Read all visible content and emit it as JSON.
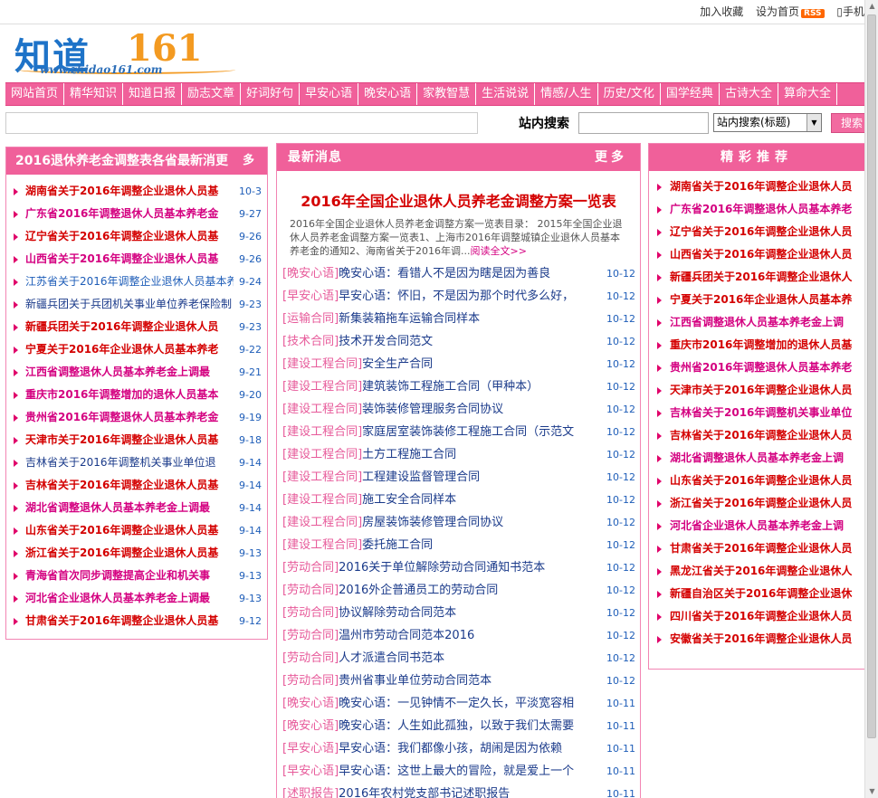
{
  "toplinks": {
    "bookmark": "加入收藏",
    "homepage": "设为首页",
    "rss": "RSS",
    "phone": "手机"
  },
  "logo": {
    "text": "知道",
    "number": "161",
    "url": "www.zhidao161.com"
  },
  "nav": {
    "items": [
      "网站首页",
      "精华知识",
      "知道日报",
      "励志文章",
      "好词好句",
      "早安心语",
      "晚安心语",
      "家教智慧",
      "生活说说",
      "情感/人生",
      "历史/文化",
      "国学经典",
      "古诗大全",
      "算命大全"
    ]
  },
  "search": {
    "label": "站内搜索",
    "select_value": "站内搜索(标题)",
    "button": "搜索"
  },
  "left_panel": {
    "title": "2016退休养老金调整表各省最新消更",
    "more": "多",
    "items": [
      {
        "title": "湖南省关于2016年调整企业退休人员基",
        "date": "10-3",
        "style": "red"
      },
      {
        "title": "广东省2016年调整退休人员基本养老金",
        "date": "9-27",
        "style": "mag"
      },
      {
        "title": "辽宁省关于2016年调整企业退休人员基",
        "date": "9-26",
        "style": "red"
      },
      {
        "title": "山西省关于2016年调整企业退休人员基",
        "date": "9-26",
        "style": "mag"
      },
      {
        "title": "江苏省关于2016年调整企业退休人员基本养",
        "date": "9-24",
        "style": "blu"
      },
      {
        "title": "新疆兵团关于兵团机关事业单位养老保险制",
        "date": "9-23",
        "style": "dbl"
      },
      {
        "title": "新疆兵团关于2016年调整企业退休人员",
        "date": "9-23",
        "style": "red"
      },
      {
        "title": "宁夏关于2016年企业退休人员基本养老",
        "date": "9-22",
        "style": "red"
      },
      {
        "title": "江西省调整退休人员基本养老金上调最",
        "date": "9-21",
        "style": "mag"
      },
      {
        "title": "重庆市2016年调整增加的退休人员基本",
        "date": "9-20",
        "style": "mag"
      },
      {
        "title": "贵州省2016年调整退休人员基本养老金",
        "date": "9-19",
        "style": "mag"
      },
      {
        "title": "天津市关于2016年调整企业退休人员基",
        "date": "9-18",
        "style": "red"
      },
      {
        "title": "吉林省关于2016年调整机关事业单位退",
        "date": "9-14",
        "style": "dbl"
      },
      {
        "title": "吉林省关于2016年调整企业退休人员基",
        "date": "9-14",
        "style": "red"
      },
      {
        "title": "湖北省调整退休人员基本养老金上调最",
        "date": "9-14",
        "style": "mag"
      },
      {
        "title": "山东省关于2016年调整企业退休人员基",
        "date": "9-14",
        "style": "red"
      },
      {
        "title": "浙江省关于2016年调整企业退休人员基",
        "date": "9-13",
        "style": "red"
      },
      {
        "title": "青海省首次同步调整提高企业和机关事",
        "date": "9-13",
        "style": "mag"
      },
      {
        "title": "河北省企业退休人员基本养老金上调最",
        "date": "9-13",
        "style": "mag"
      },
      {
        "title": "甘肃省关于2016年调整企业退休人员基",
        "date": "9-12",
        "style": "red"
      }
    ]
  },
  "mid_panel": {
    "title": "最新消息",
    "more": "更多",
    "headline": "2016年全国企业退休人员养老金调整方案一览表",
    "summary": "2016年全国企业退休人员养老金调整方案一览表目录： 2015年全国企业退休人员养老金调整方案一览表1、上海市2016年调整城镇企业退休人员基本养老金的通知2、海南省关于2016年调...",
    "readall": "阅读全文>>",
    "items": [
      {
        "cat": "[晚安心语]",
        "title": "晚安心语：看错人不是因为瞎是因为善良",
        "date": "10-12"
      },
      {
        "cat": "[早安心语]",
        "title": "早安心语：怀旧，不是因为那个时代多么好，",
        "date": "10-12"
      },
      {
        "cat": "[运输合同]",
        "title": "新集装箱拖车运输合同样本",
        "date": "10-12"
      },
      {
        "cat": "[技术合同]",
        "title": "技术开发合同范文",
        "date": "10-12"
      },
      {
        "cat": "[建设工程合同]",
        "title": "安全生产合同",
        "date": "10-12"
      },
      {
        "cat": "[建设工程合同]",
        "title": "建筑装饰工程施工合同（甲种本）",
        "date": "10-12"
      },
      {
        "cat": "[建设工程合同]",
        "title": "装饰装修管理服务合同协议",
        "date": "10-12"
      },
      {
        "cat": "[建设工程合同]",
        "title": "家庭居室装饰装修工程施工合同（示范文",
        "date": "10-12"
      },
      {
        "cat": "[建设工程合同]",
        "title": "土方工程施工合同",
        "date": "10-12"
      },
      {
        "cat": "[建设工程合同]",
        "title": "工程建设监督管理合同",
        "date": "10-12"
      },
      {
        "cat": "[建设工程合同]",
        "title": "施工安全合同样本",
        "date": "10-12"
      },
      {
        "cat": "[建设工程合同]",
        "title": "房屋装饰装修管理合同协议",
        "date": "10-12"
      },
      {
        "cat": "[建设工程合同]",
        "title": "委托施工合同",
        "date": "10-12"
      },
      {
        "cat": "[劳动合同]",
        "title": "2016关于单位解除劳动合同通知书范本",
        "date": "10-12"
      },
      {
        "cat": "[劳动合同]",
        "title": "2016外企普通员工的劳动合同",
        "date": "10-12"
      },
      {
        "cat": "[劳动合同]",
        "title": "协议解除劳动合同范本",
        "date": "10-12"
      },
      {
        "cat": "[劳动合同]",
        "title": "温州市劳动合同范本2016",
        "date": "10-12"
      },
      {
        "cat": "[劳动合同]",
        "title": "人才派遣合同书范本",
        "date": "10-12"
      },
      {
        "cat": "[劳动合同]",
        "title": "贵州省事业单位劳动合同范本",
        "date": "10-12"
      },
      {
        "cat": "[晚安心语]",
        "title": "晚安心语：一见钟情不一定久长，平淡宽容相",
        "date": "10-11"
      },
      {
        "cat": "[晚安心语]",
        "title": "晚安心语：人生如此孤独，以致于我们太需要",
        "date": "10-11"
      },
      {
        "cat": "[早安心语]",
        "title": "早安心语：我们都像小孩，胡闹是因为依赖",
        "date": "10-11"
      },
      {
        "cat": "[早安心语]",
        "title": "早安心语：这世上最大的冒险，就是爱上一个",
        "date": "10-11"
      },
      {
        "cat": "[述职报告]",
        "title": "2016年农村党支部书记述职报告",
        "date": "10-11"
      }
    ]
  },
  "right_panel": {
    "title": "精彩推荐",
    "items": [
      {
        "title": "湖南省关于2016年调整企业退休人员",
        "style": "red"
      },
      {
        "title": "广东省2016年调整退休人员基本养老",
        "style": "mag"
      },
      {
        "title": "辽宁省关于2016年调整企业退休人员",
        "style": "red"
      },
      {
        "title": "山西省关于2016年调整企业退休人员",
        "style": "red"
      },
      {
        "title": "新疆兵团关于2016年调整企业退休人",
        "style": "red"
      },
      {
        "title": "宁夏关于2016年企业退休人员基本养",
        "style": "red"
      },
      {
        "title": "江西省调整退休人员基本养老金上调",
        "style": "mag"
      },
      {
        "title": "重庆市2016年调整增加的退休人员基",
        "style": "red"
      },
      {
        "title": "贵州省2016年调整退休人员基本养老",
        "style": "mag"
      },
      {
        "title": "天津市关于2016年调整企业退休人员",
        "style": "red"
      },
      {
        "title": "吉林省关于2016年调整机关事业单位",
        "style": "mag"
      },
      {
        "title": "吉林省关于2016年调整企业退休人员",
        "style": "red"
      },
      {
        "title": "湖北省调整退休人员基本养老金上调",
        "style": "mag"
      },
      {
        "title": "山东省关于2016年调整企业退休人员",
        "style": "red"
      },
      {
        "title": "浙江省关于2016年调整企业退休人员",
        "style": "red"
      },
      {
        "title": "河北省企业退休人员基本养老金上调",
        "style": "mag"
      },
      {
        "title": "甘肃省关于2016年调整企业退休人员",
        "style": "red"
      },
      {
        "title": "黑龙江省关于2016年调整企业退休人",
        "style": "red"
      },
      {
        "title": "新疆自治区关于2016年调整企业退休",
        "style": "red"
      },
      {
        "title": "四川省关于2016年调整企业退休人员",
        "style": "red"
      },
      {
        "title": "安徽省关于2016年调整企业退休人员",
        "style": "red"
      }
    ]
  },
  "colors": {
    "accent_pink": "#f0609a",
    "panel_border": "#f285b3",
    "title_red": "#d40000",
    "title_magenta": "#d40080",
    "link_blue": "#1e5db8"
  }
}
